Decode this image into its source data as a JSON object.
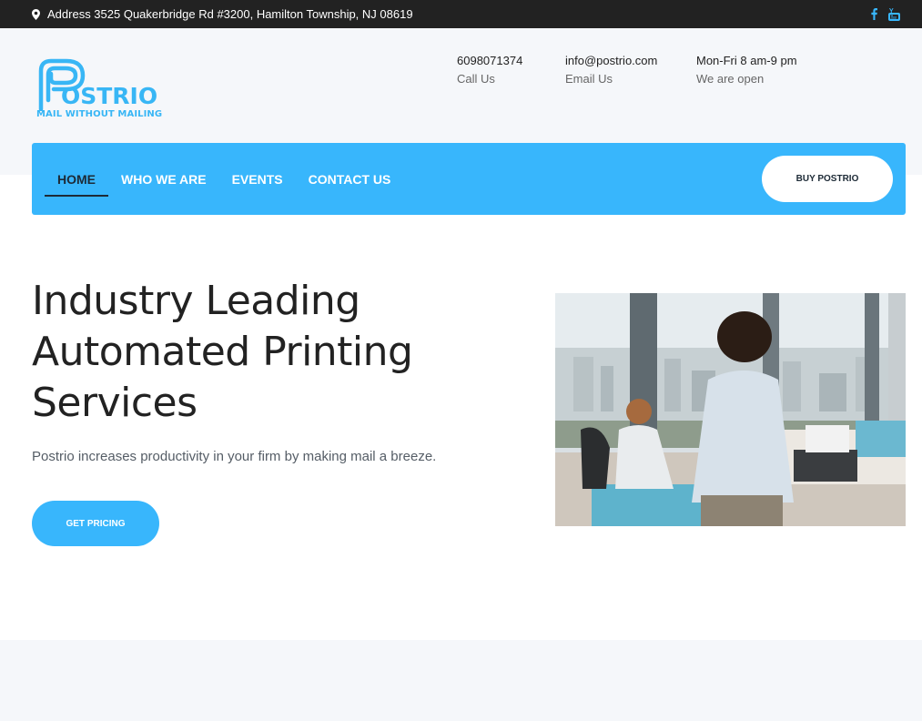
{
  "topbar": {
    "address": "Address 3525 Quakerbridge Rd #3200, Hamilton Township, NJ 08619",
    "icons": [
      "map-pin-icon",
      "facebook-icon",
      "youtube-icon"
    ]
  },
  "logo": {
    "name": "POSTRIO",
    "word_suffix": "OSTRIO",
    "tagline": "MAIL WITHOUT MAILING"
  },
  "contacts": [
    {
      "value": "6098071374",
      "label": "Call Us"
    },
    {
      "value": "info@postrio.com",
      "label": "Email Us"
    },
    {
      "value": "Mon-Fri 8 am-9 pm",
      "label": "We are open"
    }
  ],
  "nav": {
    "items": [
      {
        "label": "HOME",
        "active": true
      },
      {
        "label": "WHO WE ARE",
        "active": false
      },
      {
        "label": "EVENTS",
        "active": false
      },
      {
        "label": "CONTACT US",
        "active": false
      }
    ],
    "cta": "BUY POSTRIO"
  },
  "hero": {
    "title_lines": [
      "Industry Leading",
      "Automated Printing",
      "Services"
    ],
    "subtitle": "Postrio increases productivity in your firm by making mail a breeze.",
    "button": "GET PRICING"
  },
  "colors": {
    "accent": "#38b6fc",
    "dark": "#222222",
    "nav_active": "#1d2a36",
    "light_bg": "#f5f7fa"
  }
}
